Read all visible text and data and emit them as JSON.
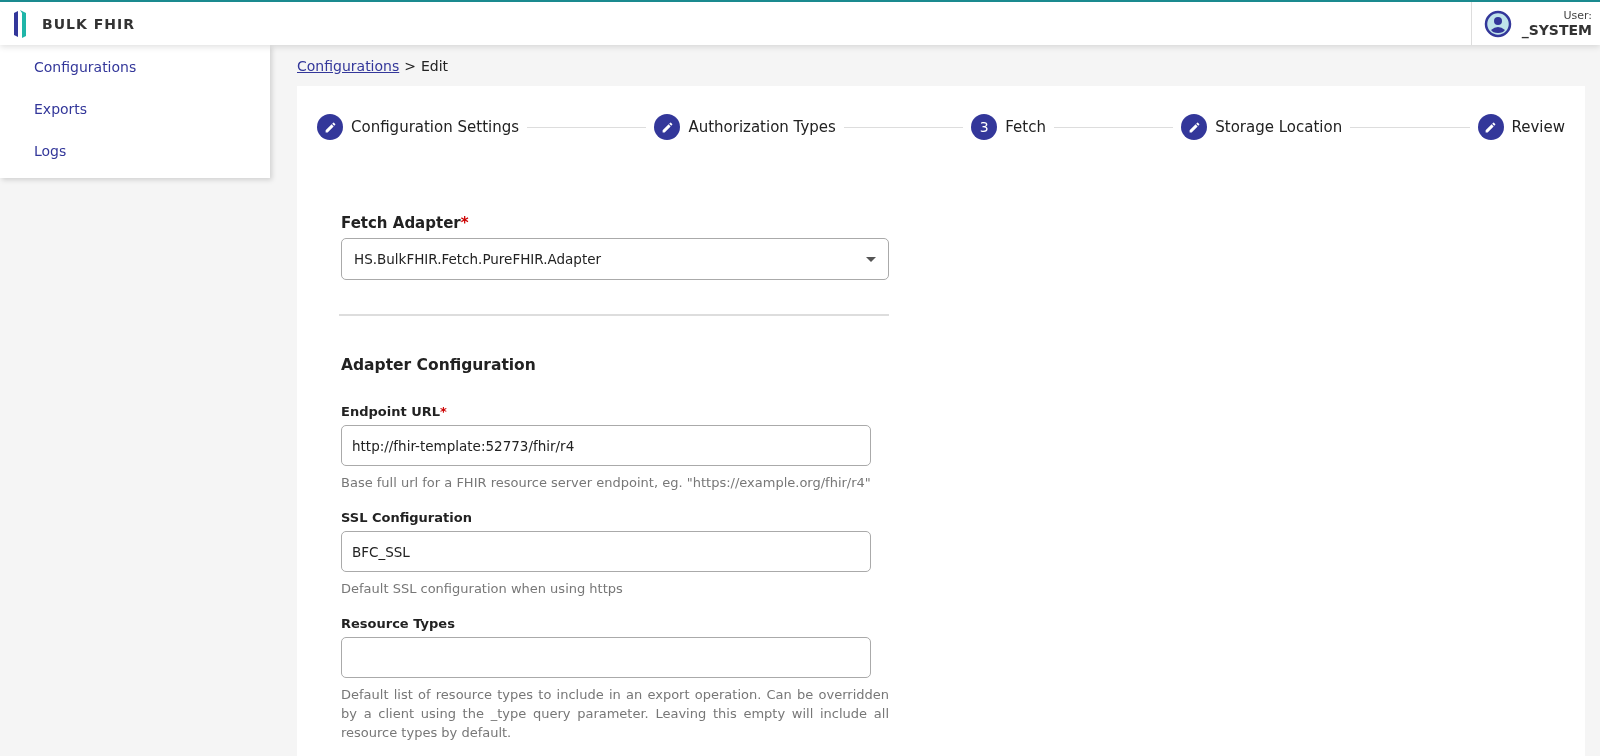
{
  "header": {
    "app_name": "BULK FHIR",
    "user_label": "User:",
    "user_name": "_SYSTEM"
  },
  "sidebar": {
    "items": [
      {
        "label": "Configurations"
      },
      {
        "label": "Exports"
      },
      {
        "label": "Logs"
      }
    ]
  },
  "breadcrumb": {
    "link": "Configurations",
    "separator": ">",
    "current": "Edit"
  },
  "stepper": [
    {
      "label": "Configuration Settings",
      "kind": "completed"
    },
    {
      "label": "Authorization Types",
      "kind": "completed"
    },
    {
      "label": "Fetch",
      "kind": "current",
      "number": "3"
    },
    {
      "label": "Storage Location",
      "kind": "completed"
    },
    {
      "label": "Review",
      "kind": "completed"
    }
  ],
  "fetch_adapter": {
    "label": "Fetch Adapter",
    "required_mark": "*",
    "value": "HS.BulkFHIR.Fetch.PureFHIR.Adapter"
  },
  "adapter_configuration": {
    "title": "Adapter Configuration",
    "fields": [
      {
        "label": "Endpoint URL",
        "required_mark": "*",
        "value": "http://fhir-template:52773/fhir/r4",
        "help": "Base full url for a FHIR resource server endpoint, eg. \"https://example.org/fhir/r4\""
      },
      {
        "label": "SSL Configuration",
        "value": "BFC_SSL",
        "help": "Default SSL configuration when using https"
      },
      {
        "label": "Resource Types",
        "help": "Default list of resource types to include in an export operation. Can be overridden by a client using the _type query parameter. Leaving this empty will include all resource types by default."
      }
    ]
  }
}
